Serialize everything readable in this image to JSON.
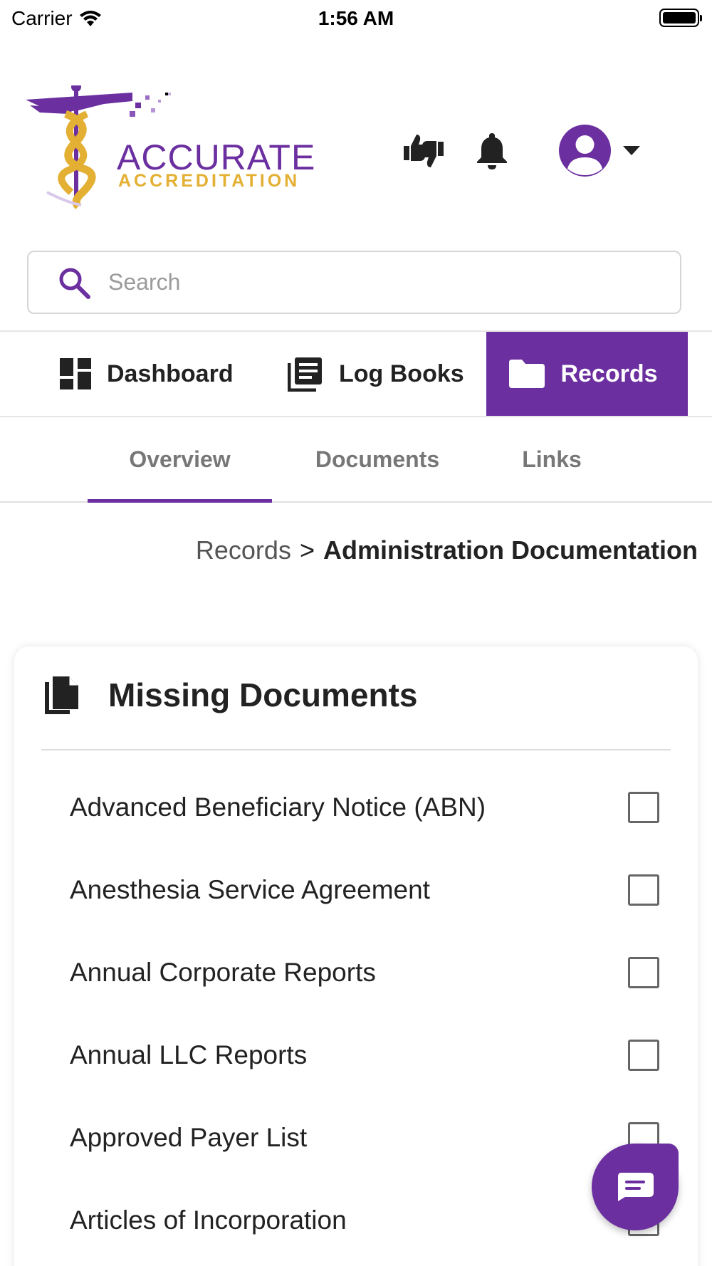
{
  "status_bar": {
    "carrier": "Carrier",
    "time": "1:56 AM"
  },
  "brand": {
    "name_top": "ACCURATE",
    "name_bottom": "ACCREDITATION",
    "primary_color": "#6b2fa0",
    "accent_color": "#e3b033"
  },
  "header": {
    "icons": [
      "thumbs-up-down-icon",
      "bell-icon",
      "account-circle-icon",
      "caret-down-icon"
    ]
  },
  "search": {
    "placeholder": "Search",
    "value": ""
  },
  "main_nav": {
    "items": [
      {
        "label": "Dashboard",
        "icon": "dashboard-icon",
        "active": false
      },
      {
        "label": "Log Books",
        "icon": "log-books-icon",
        "active": false
      },
      {
        "label": "Records",
        "icon": "folder-icon",
        "active": true
      }
    ]
  },
  "sub_tabs": {
    "items": [
      {
        "label": "Overview",
        "active": true
      },
      {
        "label": "Documents",
        "active": false
      },
      {
        "label": "Links",
        "active": false
      }
    ]
  },
  "breadcrumb": {
    "root": "Records",
    "separator": ">",
    "current": "Administration Documentation"
  },
  "missing_documents": {
    "title": "Missing Documents",
    "icon": "documents-icon",
    "items": [
      {
        "label": "Advanced Beneficiary Notice (ABN)",
        "checked": false
      },
      {
        "label": "Anesthesia Service Agreement",
        "checked": false
      },
      {
        "label": "Annual Corporate Reports",
        "checked": false
      },
      {
        "label": "Annual LLC Reports",
        "checked": false
      },
      {
        "label": "Approved Payer List",
        "checked": false
      },
      {
        "label": "Articles of Incorporation",
        "checked": false
      }
    ]
  },
  "chat": {
    "icon": "chat-icon"
  }
}
